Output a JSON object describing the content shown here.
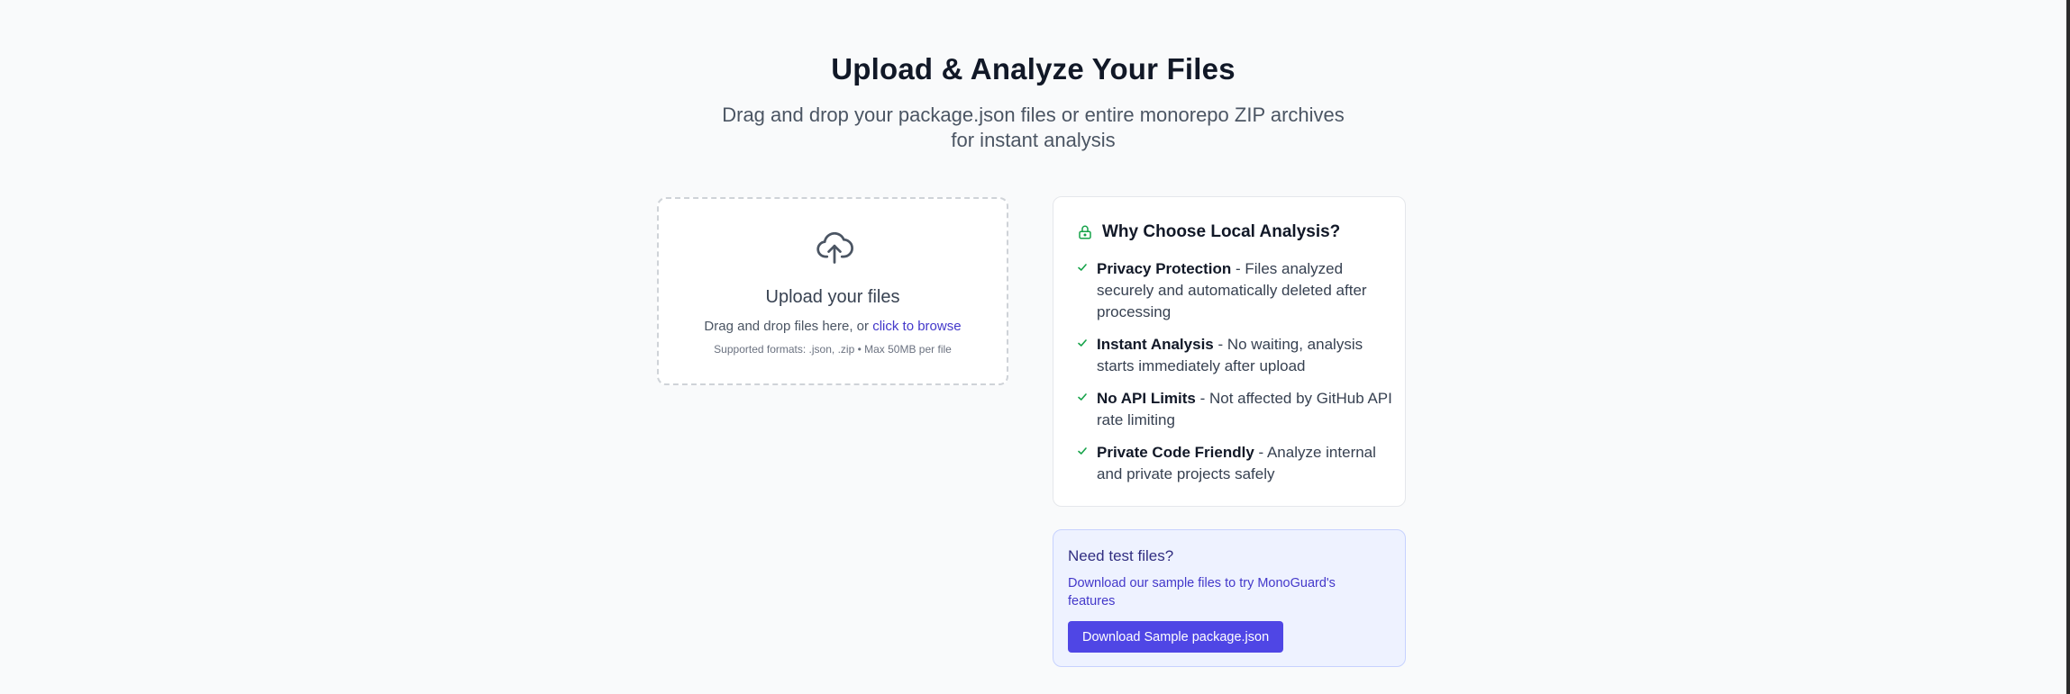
{
  "hero": {
    "title": "Upload & Analyze Your Files",
    "subtitle": "Drag and drop your package.json files or entire monorepo ZIP archives for instant analysis"
  },
  "upload": {
    "icon": "upload-cloud-icon",
    "title": "Upload your files",
    "hint_prefix": "Drag and drop files here, or ",
    "browse_link": "click to browse",
    "formats": "Supported formats: .json, .zip • Max 50MB per file"
  },
  "why": {
    "icon": "lock-icon",
    "title": "Why Choose Local Analysis?",
    "items": [
      {
        "label": "Privacy Protection",
        "text": " - Files analyzed securely and automatically deleted after processing"
      },
      {
        "label": "Instant Analysis",
        "text": " - No waiting, analysis starts immediately after upload"
      },
      {
        "label": "No API Limits",
        "text": " - Not affected by GitHub API rate limiting"
      },
      {
        "label": "Private Code Friendly",
        "text": " - Analyze internal and private projects safely"
      }
    ]
  },
  "test_files": {
    "title": "Need test files?",
    "description": "Download our sample files to try MonoGuard's features",
    "button_label": "Download Sample package.json"
  },
  "colors": {
    "accent": "#4f46e5",
    "link": "#4338ca",
    "check": "#16a34a",
    "page_background": "#f9fafb"
  }
}
